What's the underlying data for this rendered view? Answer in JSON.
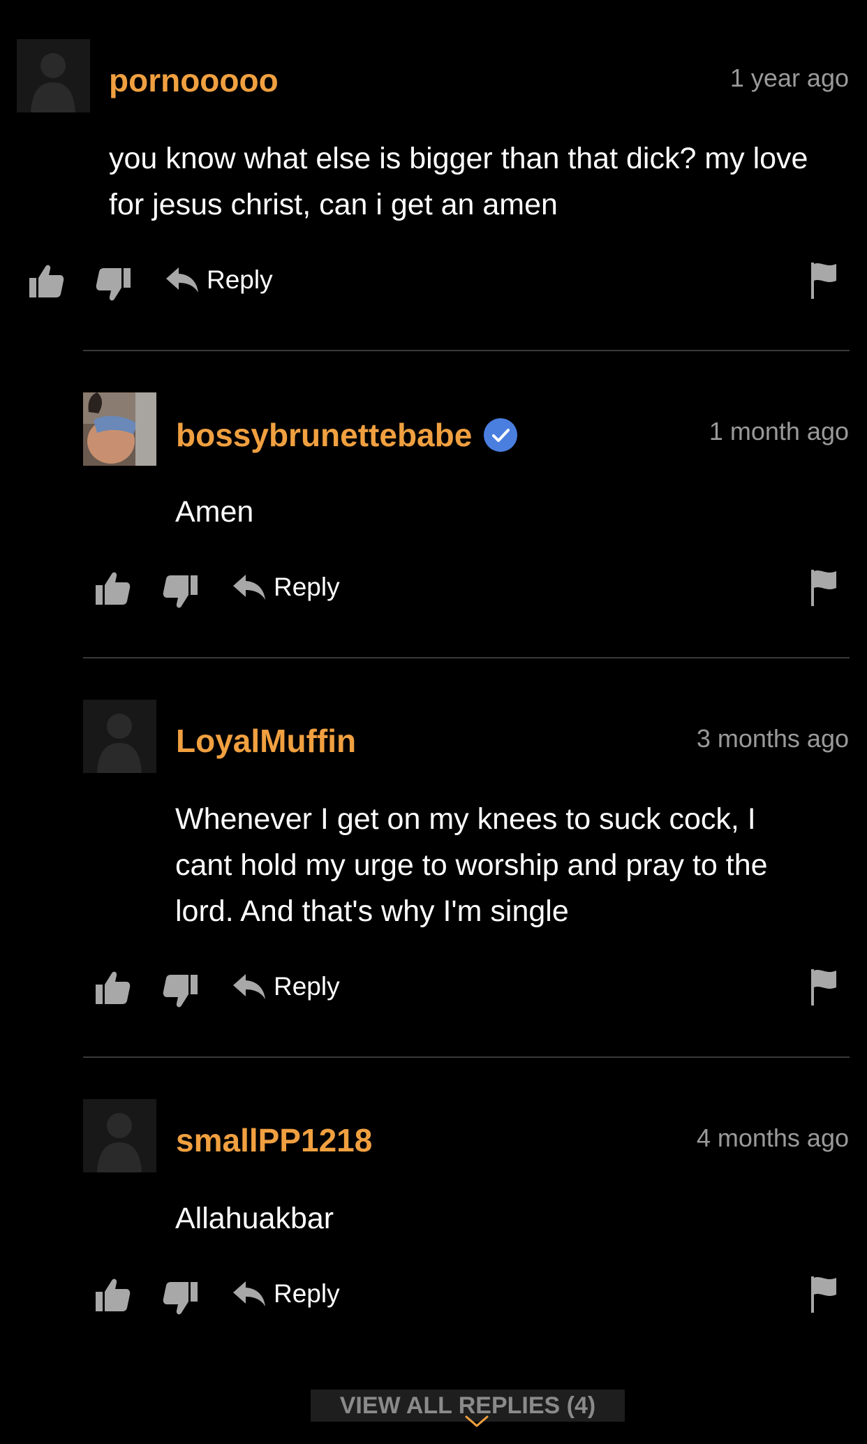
{
  "colors": {
    "background": "#000000",
    "username": "#f0a040",
    "timestamp": "#9a9a9a",
    "icon": "#a8a8a8",
    "verified_badge": "#4a7fe0",
    "divider": "#3a3a3a"
  },
  "comments": [
    {
      "username": "pornooooo",
      "verified": false,
      "timestamp": "1 year ago",
      "lines": [
        "you know what else is bigger than that dick? my love",
        "for jesus christ, can i get an amen"
      ],
      "reply_label": "Reply",
      "avatar": "default-avatar-icon"
    },
    {
      "username": "bossybrunettebabe",
      "verified": true,
      "timestamp": "1 month ago",
      "lines": [
        "Amen"
      ],
      "reply_label": "Reply",
      "avatar": "user-photo"
    },
    {
      "username": "LoyalMuffin",
      "verified": false,
      "timestamp": "3 months ago",
      "lines": [
        "Whenever I get on my knees to suck cock, I",
        "cant hold my urge to worship and pray to the",
        "lord. And that's why I'm single"
      ],
      "reply_label": "Reply",
      "avatar": "default-avatar-icon"
    },
    {
      "username": "smallPP1218",
      "verified": false,
      "timestamp": "4 months ago",
      "lines": [
        "Allahuakbar"
      ],
      "reply_label": "Reply",
      "avatar": "default-avatar-icon"
    }
  ],
  "view_all_replies": "VIEW ALL REPLIES (4)",
  "icons": {
    "thumbs_up": "thumbs-up-icon",
    "thumbs_down": "thumbs-down-icon",
    "reply": "reply-arrow-icon",
    "flag": "flag-icon",
    "verified": "verified-check-icon",
    "chevron": "chevron-down-icon"
  }
}
